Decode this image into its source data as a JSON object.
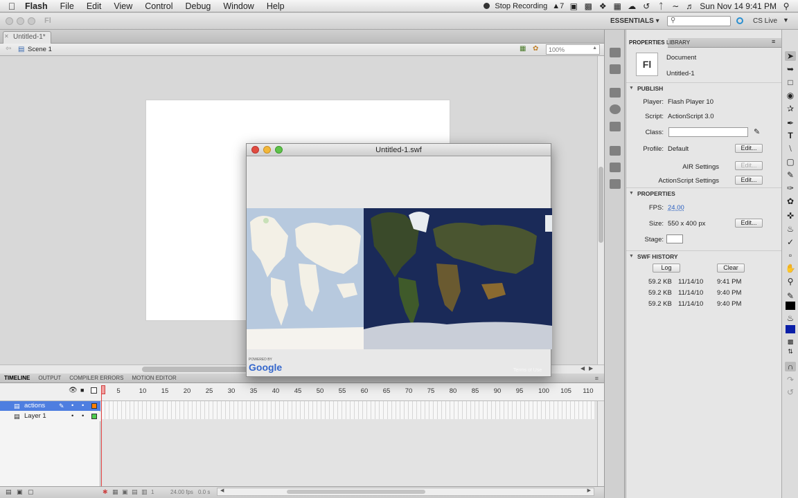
{
  "menubar": {
    "app_name": "Flash",
    "items": [
      "File",
      "Edit",
      "View",
      "Control",
      "Debug",
      "Window",
      "Help"
    ],
    "stop_recording": "Stop Recording",
    "badge": "7",
    "clock": "Sun Nov 14  9:41 PM"
  },
  "appbar": {
    "logo": "Fl",
    "workspace": "ESSENTIALS ▾",
    "cs_live": "CS Live"
  },
  "document": {
    "tab_label": "Untitled-1*",
    "scene": "Scene 1",
    "zoom": "100%"
  },
  "swf_window": {
    "title": "Untitled-1.swf",
    "powered_by": "POWERED BY",
    "google": "Google",
    "terms": "Terms of Use"
  },
  "timeline": {
    "tabs": [
      "TIMELINE",
      "OUTPUT",
      "COMPILER ERRORS",
      "MOTION EDITOR"
    ],
    "frame_numbers": [
      "5",
      "10",
      "15",
      "20",
      "25",
      "30",
      "35",
      "40",
      "45",
      "50",
      "55",
      "60",
      "65",
      "70",
      "75",
      "80",
      "85",
      "90",
      "95",
      "100",
      "105",
      "110"
    ],
    "layers": [
      {
        "name": "actions",
        "selected": true,
        "color": "#ff8000"
      },
      {
        "name": "Layer 1",
        "selected": false,
        "color": "#4fcc4f"
      }
    ],
    "status_frame": "1",
    "status_fps": "24.00 fps",
    "status_time": "0.0 s"
  },
  "properties": {
    "tabs": [
      "PROPERTIES",
      "LIBRARY"
    ],
    "doc_icon": "Fl",
    "doc_type": "Document",
    "doc_name": "Untitled-1",
    "publish_header": "PUBLISH",
    "player_label": "Player:",
    "player_value": "Flash Player 10",
    "script_label": "Script:",
    "script_value": "ActionScript 3.0",
    "class_label": "Class:",
    "profile_label": "Profile:",
    "profile_value": "Default",
    "edit": "Edit...",
    "air_settings": "AIR Settings",
    "as_settings": "ActionScript Settings",
    "props_header": "PROPERTIES",
    "fps_label": "FPS:",
    "fps_value": "24.00",
    "size_label": "Size:",
    "size_value": "550 x 400 px",
    "stage_label": "Stage:",
    "history_header": "SWF HISTORY",
    "log_btn": "Log",
    "clear_btn": "Clear",
    "history": [
      {
        "size": "59.2 KB",
        "date": "11/14/10",
        "time": "9:41 PM"
      },
      {
        "size": "59.2 KB",
        "date": "11/14/10",
        "time": "9:40 PM"
      },
      {
        "size": "59.2 KB",
        "date": "11/14/10",
        "time": "9:40 PM"
      }
    ]
  },
  "colors": {
    "selection_blue": "#4e7ee0",
    "playhead_red": "#e04040",
    "ocean_dark": "#1e2f5e"
  }
}
